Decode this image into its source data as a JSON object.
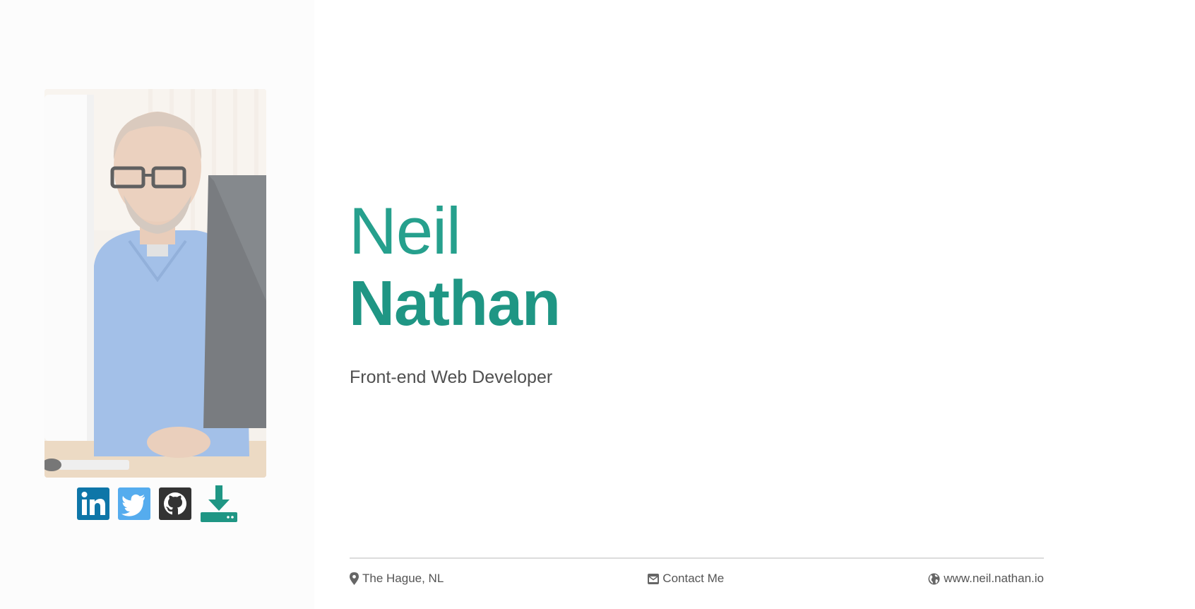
{
  "profile": {
    "first_name": "Neil",
    "last_name": "Nathan",
    "tagline": "Front-end Web Developer",
    "photo_icon": "profile-photo"
  },
  "social": [
    {
      "name": "linkedin",
      "icon": "linkedin-icon",
      "color": "#0e76a8"
    },
    {
      "name": "twitter",
      "icon": "twitter-icon",
      "color": "#55acee"
    },
    {
      "name": "github",
      "icon": "github-icon",
      "color": "#333333"
    },
    {
      "name": "download",
      "icon": "download-icon",
      "color": "#1f9684"
    }
  ],
  "footer": {
    "location": "The Hague, NL",
    "contact": "Contact Me",
    "website": "www.neil.nathan.io"
  },
  "colors": {
    "accent": "#1f9684",
    "accent_light": "#26a08d",
    "text": "#555555",
    "divider": "#dcdcdc"
  }
}
